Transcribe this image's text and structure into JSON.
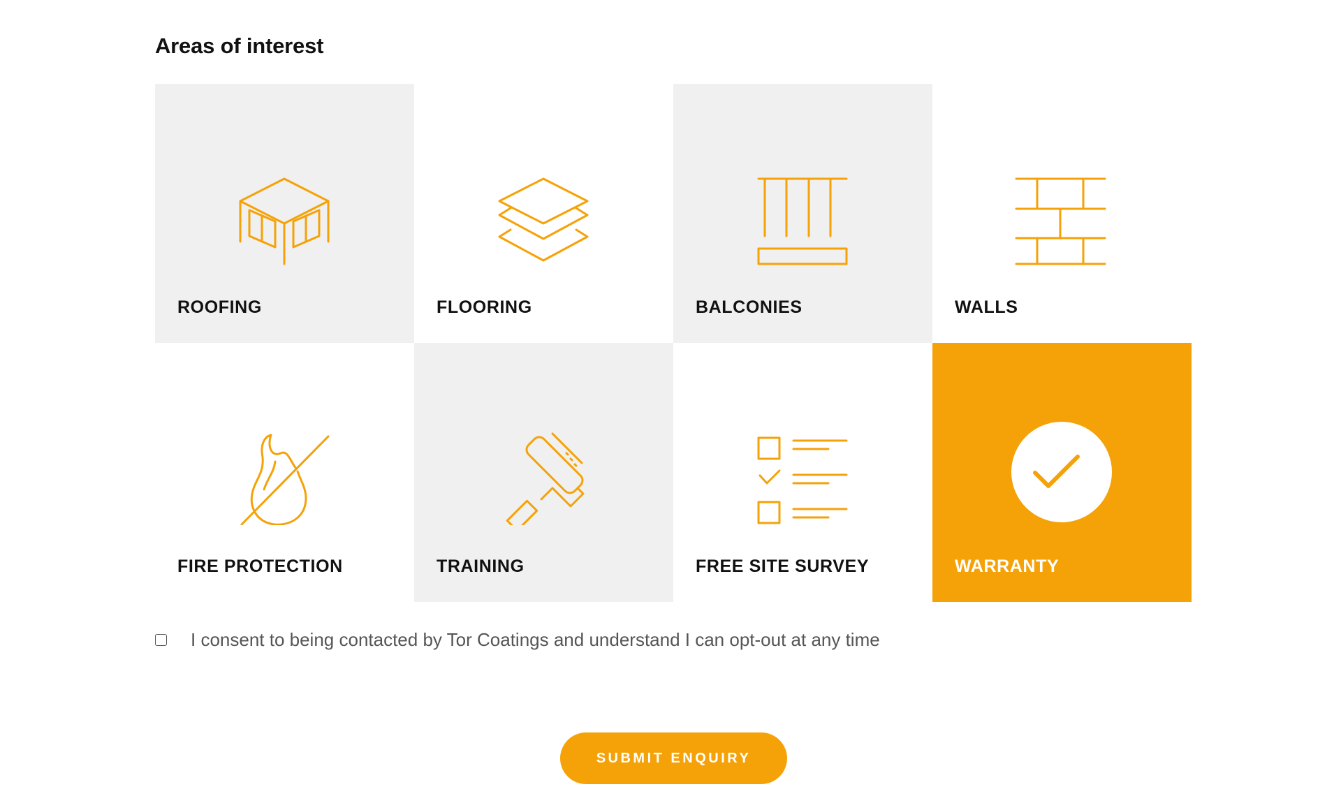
{
  "form": {
    "heading": "Areas of interest",
    "accent_color": "#f5a208",
    "tile_grey_color": "#f0f0f0",
    "tiles": [
      {
        "label": "ROOFING",
        "icon": "roofing-icon",
        "selected": false
      },
      {
        "label": "FLOORING",
        "icon": "flooring-icon",
        "selected": false
      },
      {
        "label": "BALCONIES",
        "icon": "balconies-icon",
        "selected": false
      },
      {
        "label": "WALLS",
        "icon": "walls-icon",
        "selected": false
      },
      {
        "label": "FIRE PROTECTION",
        "icon": "fire-protection-icon",
        "selected": false
      },
      {
        "label": "TRAINING",
        "icon": "paint-roller-icon",
        "selected": false
      },
      {
        "label": "FREE SITE SURVEY",
        "icon": "checklist-icon",
        "selected": false
      },
      {
        "label": "WARRANTY",
        "icon": "checkmark-circle-icon",
        "selected": true
      }
    ],
    "consent": {
      "checked": false,
      "text": "I consent to being contacted by Tor Coatings and understand I can opt-out at any time"
    },
    "submit_label": "SUBMIT ENQUIRY"
  }
}
